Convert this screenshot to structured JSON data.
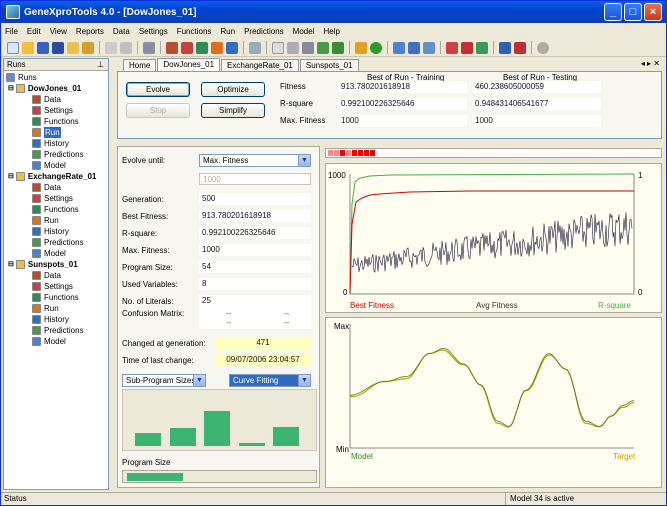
{
  "window": {
    "title": "GeneXproTools 4.0 - [DowJones_01]"
  },
  "menu": [
    "File",
    "Edit",
    "View",
    "Reports",
    "Data",
    "Settings",
    "Functions",
    "Run",
    "Predictions",
    "Model",
    "Help"
  ],
  "left_panel": {
    "title": "Runs",
    "root": "Runs",
    "runs": [
      {
        "name": "DowJones_01",
        "children": [
          "Data",
          "Settings",
          "Functions",
          "Run",
          "History",
          "Predictions",
          "Model"
        ]
      },
      {
        "name": "ExchangeRate_01",
        "children": [
          "Data",
          "Settings",
          "Functions",
          "Run",
          "History",
          "Predictions",
          "Model"
        ]
      },
      {
        "name": "Sunspots_01",
        "children": [
          "Data",
          "Settings",
          "Functions",
          "Run",
          "History",
          "Predictions",
          "Model"
        ]
      }
    ]
  },
  "tabs": [
    "Home",
    "DowJones_01",
    "ExchangeRate_01",
    "Sunspots_01"
  ],
  "controls": {
    "evolve": "Evolve",
    "optimize": "Optimize",
    "stop": "Stop",
    "simplify": "Simplify"
  },
  "best_of_run": {
    "col_training": "Best of Run - Training",
    "col_testing": "Best of Run - Testing",
    "rows": [
      {
        "label": "Fitness",
        "training": "913.780201618918",
        "testing": "460.238605000059"
      },
      {
        "label": "R-square",
        "training": "0.992100226325646",
        "testing": "0.948431406541677"
      },
      {
        "label": "Max. Fitness",
        "training": "1000",
        "testing": "1000"
      }
    ]
  },
  "stats": {
    "evolve_until_label": "Evolve until:",
    "evolve_until_value": "Max. Fitness",
    "evolve_until_number": "1000",
    "rows": [
      {
        "label": "Generation:",
        "value": "500"
      },
      {
        "label": "Best Fitness:",
        "value": "913.780201618918"
      },
      {
        "label": "R-square:",
        "value": "0.992100226325646"
      },
      {
        "label": "Max. Fitness:",
        "value": "1000"
      },
      {
        "label": "Program Size:",
        "value": "54"
      },
      {
        "label": "Used Variables:",
        "value": "8"
      },
      {
        "label": "No. of Literals:",
        "value": "25"
      }
    ],
    "confusion_label": "Confusion Matrix:",
    "confusion": [
      "--",
      "--",
      "--",
      "--"
    ],
    "changed_label": "Changed at generation:",
    "changed_value": "471",
    "time_label": "Time of last change:",
    "time_value": "09/07/2006 23:04:57",
    "dropdown_left": "Sub-Program Sizes",
    "dropdown_right": "Curve Fitting",
    "program_size_label": "Program Size"
  },
  "fitness_chart": {
    "y_top_left": "1000",
    "y_bottom_left": "0",
    "y_top_right": "1",
    "y_bottom_right": "0",
    "legend_best": "Best Fitness",
    "legend_avg": "Avg Fitness",
    "legend_r2": "R-square",
    "color_best": "#CC0000",
    "color_avg": "#1a1a3a",
    "color_r2": "#3CB34A"
  },
  "fit_chart": {
    "y_top": "Max",
    "y_bottom": "Min",
    "legend_model": "Model",
    "legend_target": "Target",
    "color_model": "#2E8B2E",
    "color_target": "#C8A000"
  },
  "histogram": {
    "values": [
      0.3,
      0.4,
      0.8,
      0.07,
      0.42
    ]
  },
  "program_size_fraction": 0.3,
  "status": {
    "left": "Status",
    "right": "Model 34 is active"
  }
}
